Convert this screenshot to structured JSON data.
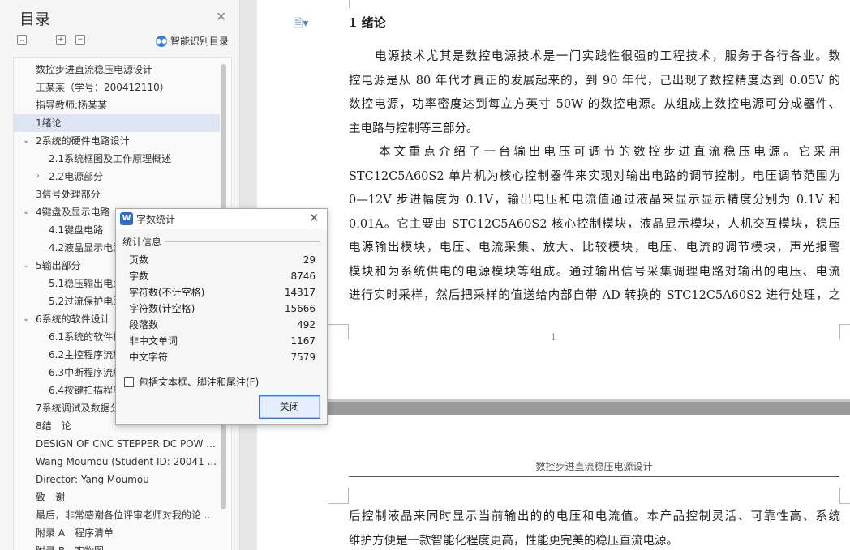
{
  "toc": {
    "title": "目录",
    "smart_label": "智能识别目录",
    "items": [
      {
        "text": "数控步进直流稳压电源设计",
        "level": 1,
        "chevron": ""
      },
      {
        "text": "王某某（学号：200412110）",
        "level": 1,
        "chevron": ""
      },
      {
        "text": "指导教师:杨某某",
        "level": 1,
        "chevron": ""
      },
      {
        "text": "1绪论",
        "level": 1,
        "chevron": "",
        "selected": true
      },
      {
        "text": "2系统的硬件电路设计",
        "level": 1,
        "chevron": "⌄"
      },
      {
        "text": "2.1系统框图及工作原理概述",
        "level": 2,
        "chevron": ""
      },
      {
        "text": "2.2电源部分",
        "level": 2,
        "chevron": "›"
      },
      {
        "text": "3信号处理部分",
        "level": 1,
        "chevron": ""
      },
      {
        "text": "4键盘及显示电路",
        "level": 1,
        "chevron": "⌄"
      },
      {
        "text": "4.1键盘电路",
        "level": 2,
        "chevron": ""
      },
      {
        "text": "4.2液晶显示电路",
        "level": 2,
        "chevron": ""
      },
      {
        "text": "5输出部分",
        "level": 1,
        "chevron": "⌄"
      },
      {
        "text": "5.1稳压输出电路",
        "level": 2,
        "chevron": ""
      },
      {
        "text": "5.2过流保护电路",
        "level": 2,
        "chevron": ""
      },
      {
        "text": "6系统的软件设计",
        "level": 1,
        "chevron": "⌄"
      },
      {
        "text": "6.1系统的软件框图",
        "level": 2,
        "chevron": ""
      },
      {
        "text": "6.2主控程序流程图",
        "level": 2,
        "chevron": ""
      },
      {
        "text": "6.3中断程序流程图",
        "level": 2,
        "chevron": ""
      },
      {
        "text": "6.4按键扫描程序",
        "level": 2,
        "chevron": ""
      },
      {
        "text": "7系统调试及数据分析",
        "level": 1,
        "chevron": ""
      },
      {
        "text": "8结　论",
        "level": 1,
        "chevron": ""
      },
      {
        "text": "DESIGN OF CNC STEPPER DC POW ...",
        "level": 1,
        "chevron": ""
      },
      {
        "text": "Wang Moumou (Student ID: 20041 ...",
        "level": 1,
        "chevron": ""
      },
      {
        "text": "Director: Yang Moumou",
        "level": 1,
        "chevron": ""
      },
      {
        "text": "致　谢",
        "level": 1,
        "chevron": ""
      },
      {
        "text": "最后，非常感谢各位评审老师对我的论 ...",
        "level": 1,
        "chevron": ""
      },
      {
        "text": "附录 A　程序清单",
        "level": 1,
        "chevron": ""
      },
      {
        "text": "附录 B　实物图",
        "level": 1,
        "chevron": ""
      }
    ]
  },
  "document": {
    "heading": "1  绪论",
    "page1_lines": [
      {
        "text": "　　电源技术尤其是数控电源技术是一门实践性很强的工程技术，服务于各行各业。数",
        "last": false
      },
      {
        "text": "控电源是从 80 年代才真正的发展起来的，到 90 年代，己出现了数控精度达到 0.05V 的",
        "last": false
      },
      {
        "text": "数控电源，功率密度达到每立方英寸 50W 的数控电源。从组成上数控电源可分成器件、",
        "last": false
      },
      {
        "text": "主电路与控制等三部分。",
        "last": true
      },
      {
        "text": "　　本文重点介绍了一台输出电压可调节的数控步进直流稳压电源。它采用",
        "last": false
      },
      {
        "text": "STC12C5A60S2 单片机为核心控制器件来实现对输出电路的调节控制。电压调节范围为",
        "last": false
      },
      {
        "text": "0—12V 步进幅度为 0.1V，输出电压和电流值通过液晶来显示显示精度分别为 0.1V 和",
        "last": false
      },
      {
        "text": "0.01A。它主要由 STC12C5A60S2 核心控制模块，液晶显示模块，人机交互模块，稳压",
        "last": false
      },
      {
        "text": "电源输出模块，电压、电流采集、放大、比较模块，电压、电流的调节模块，声光报警",
        "last": false
      },
      {
        "text": "模块和为系统供电的电源模块等组成。通过输出信号采集调理电路对输出的电压、电流",
        "last": false
      },
      {
        "text": "进行实时采样，然后把采样的值送给内部自带 AD 转换的 STC12C5A60S2 进行处理，之",
        "last": false
      }
    ],
    "page1_number": "1",
    "running_header": "数控步进直流稳压电源设计",
    "page2_lines": [
      {
        "text": "后控制液晶来同时显示当前输出的的电压和电流值。本产品控制灵活、可靠性高、系统",
        "last": false
      },
      {
        "text": "维护方便是一款智能化程度更高，性能更完美的稳压直流电源。",
        "last": true
      }
    ]
  },
  "word_count_dialog": {
    "title": "字数统计",
    "app_icon_letter": "W",
    "section_label": "统计信息",
    "stats": [
      {
        "label": "页数",
        "value": "29"
      },
      {
        "label": "字数",
        "value": "8746"
      },
      {
        "label": "字符数(不计空格)",
        "value": "14317"
      },
      {
        "label": "字符数(计空格)",
        "value": "15666"
      },
      {
        "label": "段落数",
        "value": "492"
      },
      {
        "label": "非中文单词",
        "value": "1167"
      },
      {
        "label": "中文字符",
        "value": "7579"
      }
    ],
    "checkbox_label": "包括文本框、脚注和尾注(F)",
    "checkbox_checked": false,
    "close_button": "关闭"
  },
  "colors": {
    "accent": "#3d78d8",
    "selected_row": "#dde5f3",
    "panel_bg": "#f5f5f5",
    "page_gap": "#9a9a9a"
  },
  "icons": {
    "toc_close": "close-icon",
    "smart_toc": "ai-assist-icon",
    "doc_nav": "document-icon",
    "dialog_app": "wps-writer-icon",
    "dialog_close": "close-icon"
  }
}
